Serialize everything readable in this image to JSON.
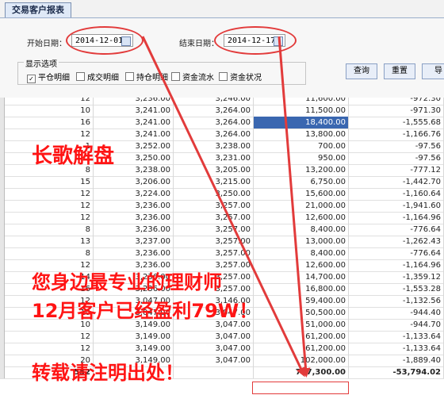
{
  "tab_title": "交易客户报表",
  "filters": {
    "start_label": "开始日期：",
    "start_value": "2014-12-01",
    "end_label": "结束日期：",
    "end_value": "2014-12-17"
  },
  "options": {
    "title": "显示选项",
    "items": [
      {
        "label": "平仓明细",
        "checked": true
      },
      {
        "label": "成交明细",
        "checked": false
      },
      {
        "label": "持仓明细",
        "checked": false
      },
      {
        "label": "资金流水",
        "checked": false
      },
      {
        "label": "资金状况",
        "checked": false
      }
    ]
  },
  "buttons": {
    "query": "查询",
    "reset": "重置",
    "export": "导"
  },
  "rows": [
    [
      "12",
      "3,236.00",
      "3,246.00",
      "11,600.00",
      "-972.30"
    ],
    [
      "10",
      "3,241.00",
      "3,264.00",
      "11,500.00",
      "-971.30"
    ],
    [
      "16",
      "3,241.00",
      "3,264.00",
      "18,400.00",
      "-1,555.68"
    ],
    [
      "12",
      "3,241.00",
      "3,264.00",
      "13,800.00",
      "-1,166.76"
    ],
    [
      "1",
      "3,252.00",
      "3,238.00",
      "700.00",
      "-97.56"
    ],
    [
      "1",
      "3,250.00",
      "3,231.00",
      "950.00",
      "-97.56"
    ],
    [
      "8",
      "3,238.00",
      "3,205.00",
      "13,200.00",
      "-777.12"
    ],
    [
      "15",
      "3,206.00",
      "3,215.00",
      "6,750.00",
      "-1,442.70"
    ],
    [
      "12",
      "3,224.00",
      "3,250.00",
      "15,600.00",
      "-1,160.64"
    ],
    [
      "12",
      "3,236.00",
      "3,257.00",
      "21,000.00",
      "-1,941.60"
    ],
    [
      "12",
      "3,236.00",
      "3,257.00",
      "12,600.00",
      "-1,164.96"
    ],
    [
      "8",
      "3,236.00",
      "3,257.00",
      "8,400.00",
      "-776.64"
    ],
    [
      "13",
      "3,237.00",
      "3,257.00",
      "13,000.00",
      "-1,262.43"
    ],
    [
      "8",
      "3,236.00",
      "3,257.00",
      "8,400.00",
      "-776.64"
    ],
    [
      "12",
      "3,236.00",
      "3,257.00",
      "12,600.00",
      "-1,164.96"
    ],
    [
      "14",
      "3,236.00",
      "3,257.00",
      "14,700.00",
      "-1,359.12"
    ],
    [
      "16",
      "3,236.00",
      "3,257.00",
      "16,800.00",
      "-1,553.28"
    ],
    [
      "12",
      "3,047.00",
      "3,146.00",
      "59,400.00",
      "-1,132.56"
    ],
    [
      "10",
      "3,047.00",
      "3,047.00",
      "50,500.00",
      "-944.40"
    ],
    [
      "10",
      "3,149.00",
      "3,047.00",
      "51,000.00",
      "-944.70"
    ],
    [
      "12",
      "3,149.00",
      "3,047.00",
      "61,200.00",
      "-1,133.64"
    ],
    [
      "12",
      "3,149.00",
      "3,047.00",
      "61,200.00",
      "-1,133.64"
    ],
    [
      "20",
      "3,149.00",
      "3,047.00",
      "102,000.00",
      "-1,889.40"
    ]
  ],
  "selected_row": 2,
  "total": {
    "count": "552",
    "amount": "797,300.00",
    "fee": "-53,794.02"
  },
  "overlay": {
    "line1": "长歌解盘",
    "line2": "您身边最专业的理财师",
    "line3": "12月客户已经盈利79W！",
    "line4": "转载请注明出处！"
  },
  "colors": {
    "annotation_red": "#ff1414",
    "selected_row_bg": "#3a67b0"
  }
}
